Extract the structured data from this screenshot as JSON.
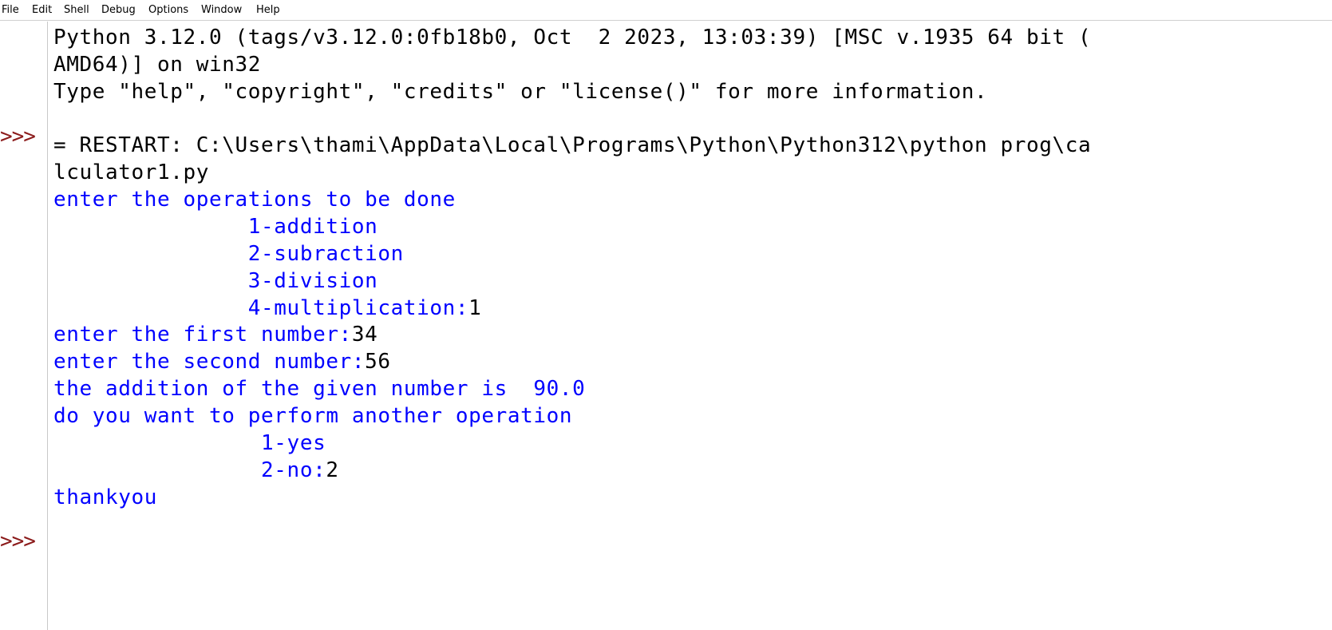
{
  "menu": {
    "file": "File",
    "edit": "Edit",
    "shell": "Shell",
    "debug": "Debug",
    "options": "Options",
    "window": "Window",
    "help": "Help"
  },
  "gutter": {
    "prompt_1": ">>>",
    "prompt_2": ">>>"
  },
  "shell": {
    "banner_1": "Python 3.12.0 (tags/v3.12.0:0fb18b0, Oct  2 2023, 13:03:39) [MSC v.1935 64 bit (",
    "banner_2": "AMD64)] on win32",
    "banner_3": "Type \"help\", \"copyright\", \"credits\" or \"license()\" for more information.",
    "restart_1": "= RESTART: C:\\Users\\thami\\AppData\\Local\\Programs\\Python\\Python312\\python prog\\ca",
    "restart_2": "lculator1.py",
    "ops_prompt": "enter the operations to be done",
    "op_1": "               1-addition",
    "op_2": "               2-subraction",
    "op_3": "               3-division",
    "op_4": "               4-multiplication:",
    "op_input": "1",
    "first_prompt": "enter the first number:",
    "first_input": "34",
    "second_prompt": "enter the second number:",
    "second_input": "56",
    "result": "the addition of the given number is  90.0",
    "again_prompt": "do you want to perform another operation",
    "again_yes": "                1-yes",
    "again_no": "                2-no:",
    "again_input": "2",
    "thanks": "thankyou"
  },
  "colors": {
    "stdout": "#0000ff",
    "stdin": "#000000",
    "prompt": "#8b1a1a"
  }
}
